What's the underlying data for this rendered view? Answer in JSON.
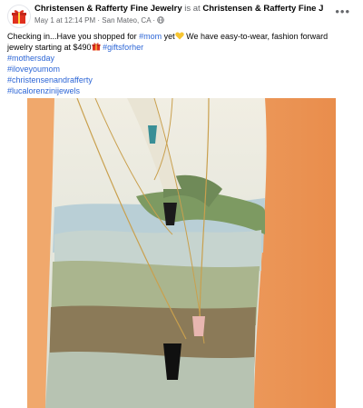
{
  "post": {
    "page_name": "Christensen & Rafferty Fine Jewelry",
    "connector": "is at",
    "location_name": "Christensen & Rafferty Fine Jewelry",
    "period": ".",
    "date": "May 1 at 12:14 PM",
    "separator": "·",
    "city": "San Mateo, CA",
    "audience_icon": "globe-icon",
    "more_icon": "ellipsis-icon",
    "more_label": "•••",
    "text_part1": "Checking in...Have you shopped for",
    "tag_mom": "#mom",
    "text_part2": "yet",
    "text_part3": "We have easy-to-wear, fashion forward jewelry starting at $490",
    "tag_giftsforher": "#giftsforher",
    "hashtags": [
      "#mothersday",
      "#iloveyoumom",
      "#christensenandrafferty",
      "#lucalorenzinijewels"
    ]
  },
  "colors": {
    "link": "#2d66d6",
    "muted": "#65676b",
    "text": "#050505",
    "background": "#ffffff",
    "brand_red": "#e0301e"
  }
}
